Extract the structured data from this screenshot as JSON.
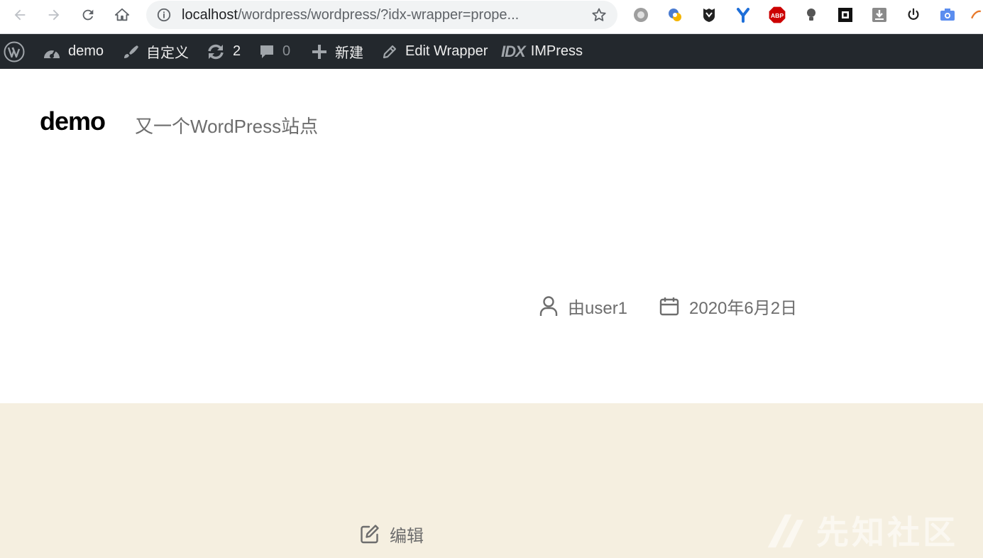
{
  "browser": {
    "url_host": "localhost",
    "url_path": "/wordpress/wordpress/?idx-wrapper=prope..."
  },
  "admin_bar": {
    "site_name": "demo",
    "customize": "自定义",
    "updates_count": "2",
    "comments_count": "0",
    "new": "新建",
    "edit": "Edit Wrapper",
    "impress_logo": "IDX",
    "impress": "IMPress"
  },
  "site": {
    "title": "demo",
    "description": "又一个WordPress站点"
  },
  "post_meta": {
    "author": "由user1",
    "date": "2020年6月2日"
  },
  "footer": {
    "edit_label": "编辑"
  },
  "watermark": {
    "text": "先知社区"
  },
  "colors": {
    "admin_bar_bg": "#23282d",
    "band_bg": "#f5efe0",
    "meta_text": "#6d6d6d"
  }
}
